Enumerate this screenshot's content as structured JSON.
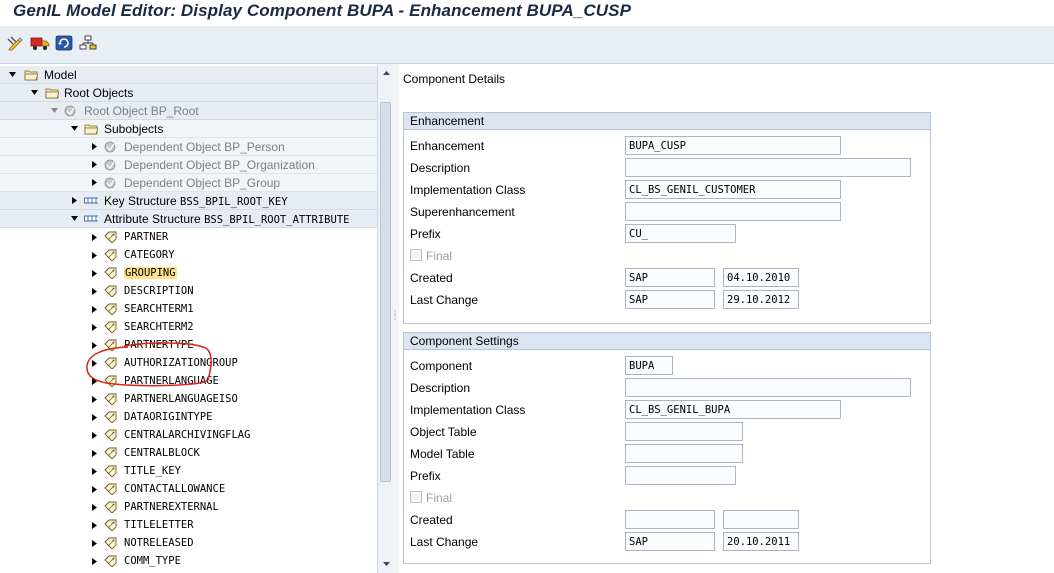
{
  "window": {
    "title": "GenIL Model Editor: Display Component  BUPA - Enhancement BUPA_CUSP"
  },
  "toolbar": {
    "buttons": [
      {
        "name": "display-change-icon"
      },
      {
        "name": "transport-icon"
      },
      {
        "name": "refresh-icon"
      },
      {
        "name": "hierarchy-icon"
      }
    ]
  },
  "tree": {
    "model": "Model",
    "root_objects": "Root Objects",
    "root_object": "Root Object BP_Root",
    "subobjects": "Subobjects",
    "dep_person": "Dependent Object BP_Person",
    "dep_org": "Dependent Object BP_Organization",
    "dep_group": "Dependent Object BP_Group",
    "key_structure_label": "Key Structure",
    "key_structure_value": "BSS_BPIL_ROOT_KEY",
    "attr_structure_label": "Attribute Structure",
    "attr_structure_value": "BSS_BPIL_ROOT_ATTRIBUTE",
    "attributes": [
      "PARTNER",
      "CATEGORY",
      "GROUPING",
      "DESCRIPTION",
      "SEARCHTERM1",
      "SEARCHTERM2",
      "PARTNERTYPE",
      "AUTHORIZATIONGROUP",
      "PARTNERLANGUAGE",
      "PARTNERLANGUAGEISO",
      "DATAORIGINTYPE",
      "CENTRALARCHIVINGFLAG",
      "CENTRALBLOCK",
      "TITLE_KEY",
      "CONTACTALLOWANCE",
      "PARTNEREXTERNAL",
      "TITLELETTER",
      "NOTRELEASED",
      "COMM_TYPE"
    ],
    "highlighted": "GROUPING"
  },
  "details": {
    "title": "Component Details",
    "enhancement": {
      "header": "Enhancement",
      "enhancement_label": "Enhancement",
      "enhancement_value": "BUPA_CUSP",
      "description_label": "Description",
      "description_value": "",
      "impl_class_label": "Implementation Class",
      "impl_class_value": "CL_BS_GENIL_CUSTOMER",
      "superenh_label": "Superenhancement",
      "superenh_value": "",
      "prefix_label": "Prefix",
      "prefix_value": "CU_",
      "final_label": "Final",
      "created_label": "Created",
      "created_user": "SAP",
      "created_date": "04.10.2010",
      "last_change_label": "Last Change",
      "last_change_user": "SAP",
      "last_change_date": "29.10.2012"
    },
    "component": {
      "header": "Component Settings",
      "component_label": "Component",
      "component_value": "BUPA",
      "description_label": "Description",
      "description_value": "",
      "impl_class_label": "Implementation Class",
      "impl_class_value": "CL_BS_GENIL_BUPA",
      "object_table_label": "Object Table",
      "object_table_value": "",
      "model_table_label": "Model Table",
      "model_table_value": "",
      "prefix_label": "Prefix",
      "prefix_value": "",
      "final_label": "Final",
      "created_label": "Created",
      "created_user": "",
      "created_date": "",
      "last_change_label": "Last Change",
      "last_change_user": "SAP",
      "last_change_date": "20.10.2011"
    }
  }
}
